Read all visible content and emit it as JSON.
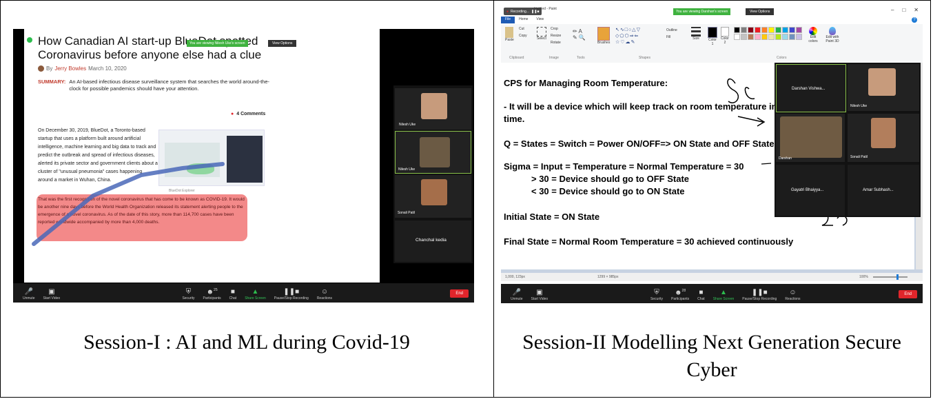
{
  "panel_left": {
    "caption": "Session-I : AI and ML during Covid-19",
    "share_banner": "You are viewing Nilesh Uke's screen",
    "view_options": "View Options",
    "article": {
      "title": "How Canadian AI start-up BlueDot spotted Coronavirus before anyone else had a clue",
      "byline_prefix": "By",
      "author": "Jerry Bowles",
      "date": "March 10, 2020",
      "summary_label": "SUMMARY:",
      "summary_text": "An AI-based infectious disease surveillance system that searches the world around-the-clock for possible pandemics should have your attention.",
      "comments": "4 Comments",
      "paragraph": "On December 30, 2019, BlueDot, a Toronto-based startup that uses a platform built around artificial intelligence, machine learning and big data to track and predict the outbreak and spread of infectious diseases, alerted its private sector and government clients about a cluster of \"unusual pneumonia\" cases happening around a market in Wuhan, China.",
      "image_caption": "BlueDot Explorer",
      "highlight_text": "That was the first recognition of the novel coronavirus that has come to be known as COVID-19. It would be another nine days before the World Health Organization released its statement alerting people to the emergence of a novel coronavirus. As of the date of this story, more than 114,700 cases have been reported worldwide accompanied by more than 4,000 deaths."
    },
    "participants": [
      "Nilesh Uke",
      "Nilesh Uke",
      "Sonali Patil",
      "Chanchal kedia"
    ],
    "toolbar": {
      "unmute": "Unmute",
      "start_video": "Start Video",
      "security": "Security",
      "participants": "Participants",
      "participants_count": "25",
      "chat": "Chat",
      "share_screen": "Share Screen",
      "pause_recording": "Pause/Stop Recording",
      "reactions": "Reactions",
      "end": "End"
    }
  },
  "panel_right": {
    "caption": "Session-II Modelling Next Generation Secure Cyber",
    "share_banner": "You are viewing Darshan's screen",
    "view_options": "View Options",
    "paint": {
      "title": "Untitled - Paint",
      "recording": "Recording...",
      "tabs": [
        "File",
        "Home",
        "View"
      ],
      "groups": [
        "Clipboard",
        "Image",
        "Tools",
        "Shapes",
        "Colors"
      ],
      "tools": {
        "paste": "Paste",
        "cut": "Cut",
        "copy": "Copy",
        "select": "Select",
        "crop": "Crop",
        "resize": "Resize",
        "rotate": "Rotate",
        "brushes": "Brushes",
        "size": "Size",
        "color1": "Color 1",
        "color2": "Color 2",
        "edit_colors": "Edit colors",
        "edit_paint3d": "Edit with Paint 3D",
        "outline": "Outline",
        "fill": "Fill"
      },
      "palette": [
        "#000000",
        "#7f7f7f",
        "#880015",
        "#ed1c24",
        "#ff7f27",
        "#fff200",
        "#22b14c",
        "#00a2e8",
        "#3f48cc",
        "#a349a4",
        "#ffffff",
        "#c3c3c3",
        "#b97a57",
        "#ffaec9",
        "#ffc90e",
        "#efe4b0",
        "#b5e61d",
        "#99d9ea",
        "#7092be",
        "#c8bfe7"
      ],
      "lines": [
        "CPS for Managing Room Temperature:",
        "- It will be a device which will keep track on room temperature in r",
        "time.",
        "Q = States = Switch = Power ON/OFF=> ON State and OFF State",
        "Sigma = Input = Temperature = Normal Temperature = 30",
        "> 30 = Device should go to OFF State",
        "< 30 = Device should go to ON State",
        "Initial State = ON State",
        "Final State = Normal Room Temperature = 30 achieved continuously"
      ],
      "status_left": "1,000, 123px",
      "status_mid": "1299 × 985px",
      "status_zoom": "100%"
    },
    "participants": [
      "Darshan Vishwa...",
      "Nilesh Uke",
      "Darshan",
      "Sonali Patil",
      "Gayatri Bhaiyya...",
      "Amar Subhash..."
    ],
    "toolbar": {
      "unmute": "Unmute",
      "start_video": "Start Video",
      "security": "Security",
      "participants": "Participants",
      "participants_count": "28",
      "chat": "Chat",
      "share_screen": "Share Screen",
      "pause_recording": "Pause/Stop Recording",
      "reactions": "Reactions",
      "end": "End"
    }
  }
}
